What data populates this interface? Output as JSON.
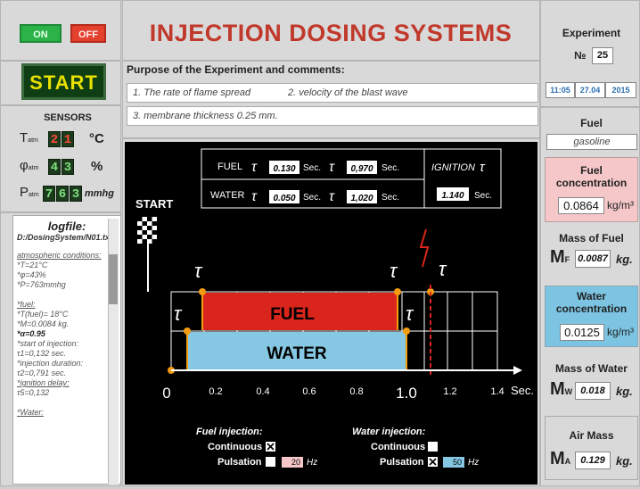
{
  "controls": {
    "on_label": "ON",
    "off_label": "OFF",
    "start_label": "START"
  },
  "header": {
    "title": "INJECTION DOSING SYSTEMS"
  },
  "purpose": {
    "heading": "Purpose of the Experiment and comments:",
    "line1a": "1. The rate of flame spread",
    "line1b": "2. velocity of the blast wave",
    "line2": "3. membrane thickness 0.25 mm."
  },
  "sensors": {
    "heading": "SENSORS",
    "temperature": {
      "label": "T",
      "sub": "atm",
      "digits": [
        "2",
        "1"
      ],
      "unit": "°C"
    },
    "humidity": {
      "label": "φ",
      "sub": "atm",
      "digits": [
        "4",
        "3"
      ],
      "unit": "%"
    },
    "pressure": {
      "label": "P",
      "sub": "atm",
      "digits": [
        "7",
        "6",
        "3"
      ],
      "unit": "mmhg"
    }
  },
  "logfile": {
    "title": "logfile:",
    "path": "D:/DosingSystem/N01.txt",
    "lines": [
      "atmospheric conditions:",
      "*T=21°C",
      "*φ=43%",
      "*P=763mmhg",
      "",
      "*fuel:",
      "*T(fuel)= 18°C",
      "*M=0.0084 kg.",
      "*α=0.95",
      "*start of injection:",
      "τ1=0,132 sec.",
      "*injection duration:",
      "τ2=0,791 sec.",
      "*ignition delay:",
      "τ5=0,132",
      "",
      "*Water:"
    ]
  },
  "diagram": {
    "fuel_label": "FUEL",
    "water_label": "WATER",
    "tau_symbol": "τ",
    "fuel_tau1": "0.130",
    "fuel_tau2": "0,970",
    "water_tau1": "0.050",
    "water_tau2": "1,020",
    "sec": "Sec.",
    "ignition_label": "IGNITION",
    "ignition_value": "1.140",
    "start_label": "START",
    "axis_ticks": [
      "0",
      "0.2",
      "0.4",
      "0.6",
      "0.8",
      "1.0",
      "1.2",
      "1.4"
    ],
    "axis_unit": "Sec.",
    "fuel_injection": {
      "heading": "Fuel injection:",
      "continuous": "Continuous",
      "pulsation": "Pulsation",
      "freq": "20",
      "hz": "Hz",
      "continuous_checked": true,
      "pulsation_checked": false
    },
    "water_injection": {
      "heading": "Water injection:",
      "continuous": "Continuous",
      "pulsation": "Pulsation",
      "freq": "50",
      "hz": "Hz",
      "continuous_checked": false,
      "pulsation_checked": true
    }
  },
  "right": {
    "experiment_label": "Experiment",
    "no_label": "№",
    "no_value": "25",
    "time": "11:05",
    "date": "27.04",
    "year": "2015",
    "fuel_label": "Fuel",
    "fuel_value": "gasoline",
    "fuel_conc_label": "Fuel concentration",
    "fuel_conc_value": "0.0864",
    "conc_unit": "kg/m³",
    "mass_fuel_label": "Mass of Fuel",
    "mass_fuel_symbol": "M",
    "mass_fuel_sub": "F",
    "mass_fuel_value": "0.0087",
    "kg": "kg.",
    "water_conc_label": "Water concentration",
    "water_conc_value": "0.0125",
    "mass_water_label": "Mass of Water",
    "mass_water_symbol": "M",
    "mass_water_sub": "W",
    "mass_water_value": "0.018",
    "air_mass_label": "Air Mass",
    "air_mass_symbol": "M",
    "air_mass_sub": "A",
    "air_mass_value": "0.129"
  },
  "colors": {
    "fuel": "#d9251b",
    "water": "#86c8e4",
    "marker": "#f39c12",
    "title": "#c0392b"
  }
}
